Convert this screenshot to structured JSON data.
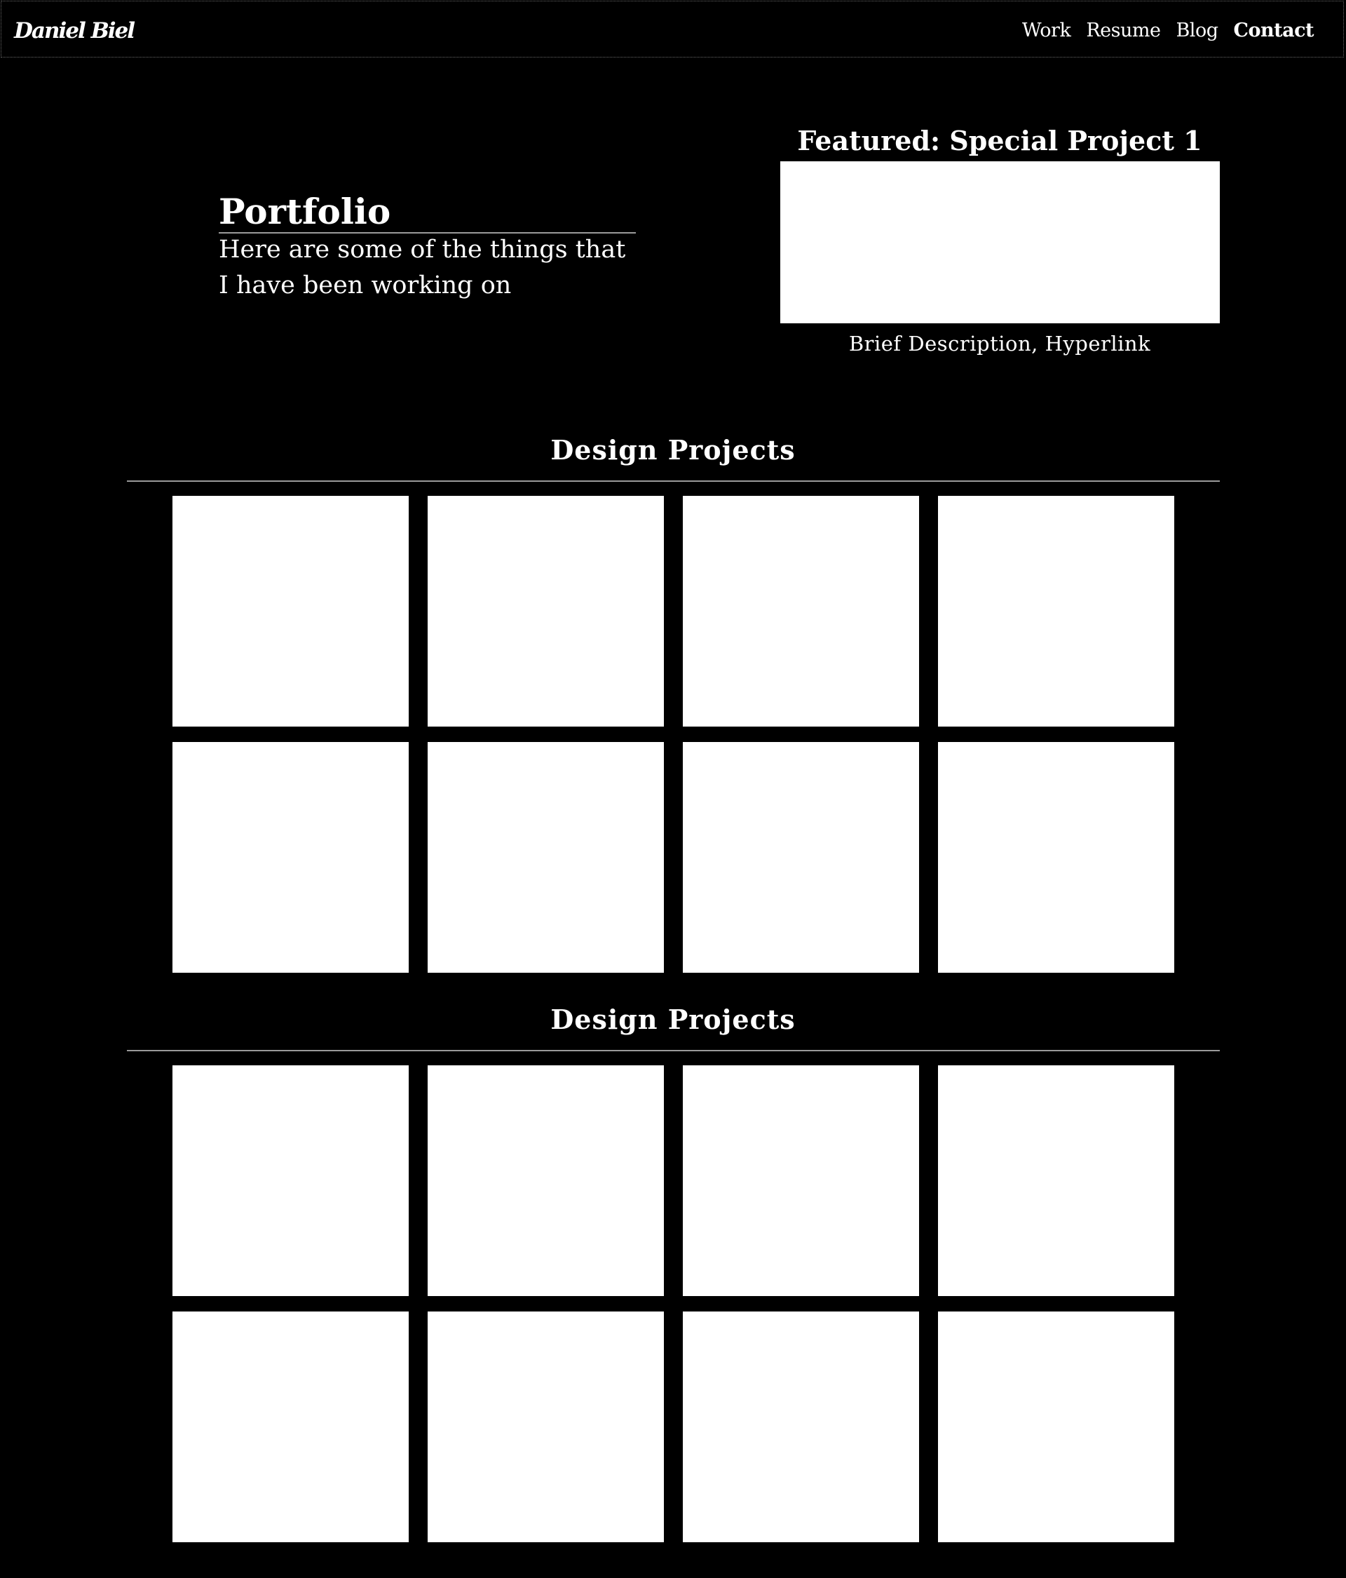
{
  "header": {
    "logo": "Daniel Biel",
    "nav": [
      {
        "label": "Work"
      },
      {
        "label": "Resume"
      },
      {
        "label": "Blog"
      },
      {
        "label": "Contact",
        "active": true
      }
    ]
  },
  "intro": {
    "title": "Portfolio",
    "subtitle_line1": "Here are some of the things that",
    "subtitle_line2": "I have been working on"
  },
  "featured": {
    "title": "Featured: Special Project 1",
    "description": "Brief Description, Hyperlink"
  },
  "sections": [
    {
      "title": "Design Projects",
      "tile_count": 8
    },
    {
      "title": "Design Projects",
      "tile_count": 8
    }
  ],
  "colors": {
    "background": "#000000",
    "text": "#ffffff",
    "tile": "#ffffff",
    "rule": "#9a9a9a"
  }
}
